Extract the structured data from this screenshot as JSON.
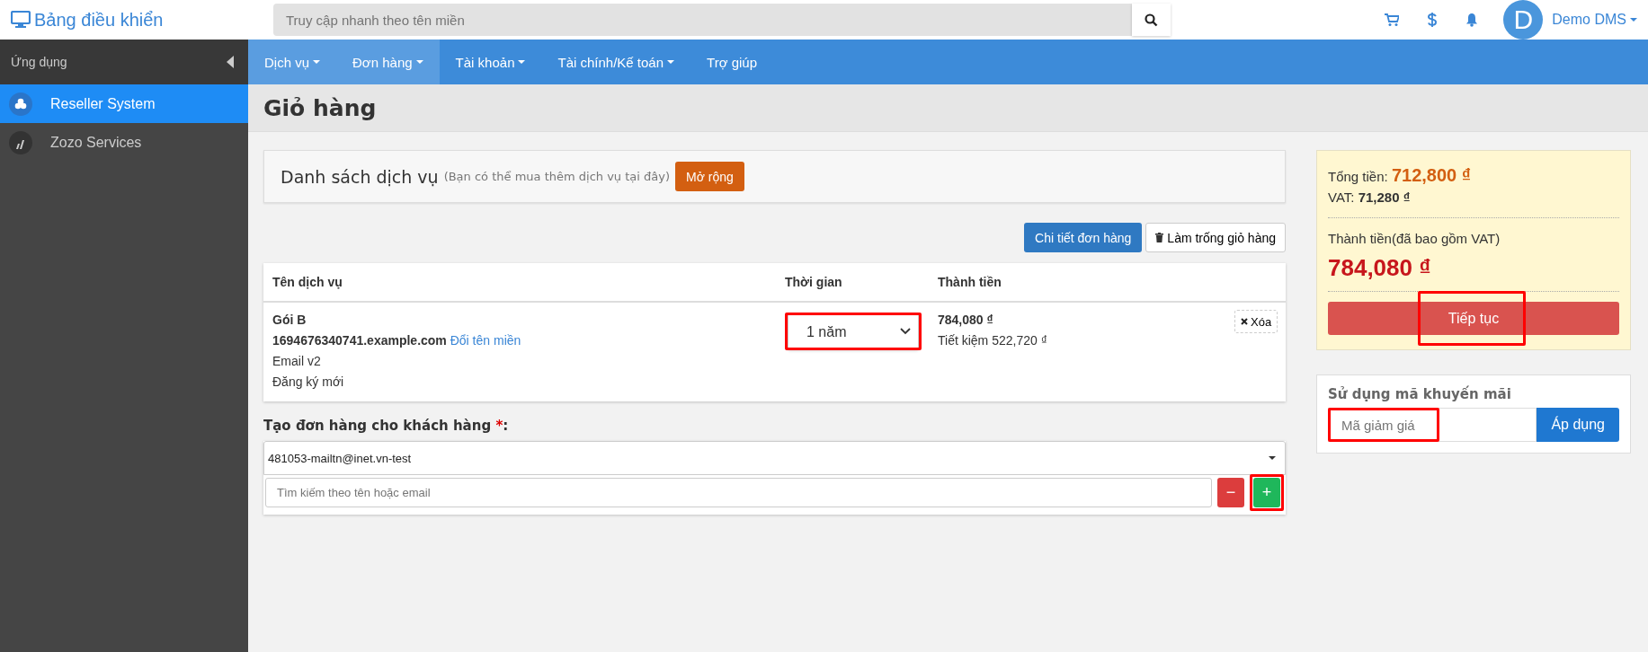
{
  "header": {
    "brand": "Bảng điều khiển",
    "search": {
      "placeholder": "Truy cập nhanh theo tên miền"
    },
    "avatar_letter": "D",
    "user": "Demo DMS"
  },
  "sidebar": {
    "title": "Ứng dụng",
    "items": [
      {
        "label": "Reseller System",
        "selected": true
      },
      {
        "label": "Zozo Services",
        "selected": false
      }
    ]
  },
  "nav": [
    {
      "label": "Dịch vụ",
      "dropdown": true,
      "selected": true
    },
    {
      "label": "Đơn hàng",
      "dropdown": true,
      "selected": true
    },
    {
      "label": "Tài khoản",
      "dropdown": true,
      "selected": false
    },
    {
      "label": "Tài chính/Kế toán",
      "dropdown": true,
      "selected": false
    },
    {
      "label": "Trợ giúp",
      "dropdown": false,
      "selected": false
    }
  ],
  "page_title": "Giỏ hàng",
  "services_card": {
    "title": "Danh sách dịch vụ",
    "note": "(Bạn có thể mua thêm dịch vụ tại đây)",
    "button": "Mở rộng"
  },
  "actions": [
    "Chi tiết đơn hàng",
    "Làm trống giỏ hàng"
  ],
  "table": {
    "columns": [
      "Tên dịch vụ",
      "Thời gian",
      "Thành tiền"
    ],
    "rows": [
      {
        "name": "Gói B",
        "domain": "1694676340741.example.com",
        "rename_link": "Đổi tên miền",
        "lines": [
          "Email v2",
          "Đăng ký mới"
        ],
        "period": "1 năm",
        "price": "784,080 ₫",
        "saving": "Tiết kiệm 522,720 ₫",
        "delete": "Xóa"
      }
    ]
  },
  "customer": {
    "label": "Tạo đơn hàng cho khách hàng",
    "required": "*",
    "suffix": ":",
    "selected": "481053-mailtn@inet.vn-test",
    "search": {
      "placeholder": "Tìm kiếm theo tên hoặc email"
    },
    "minus": "−",
    "plus": "+"
  },
  "summary": {
    "total_label": "Tổng tiền:",
    "total": "712,800 ₫",
    "vat_label": "VAT:",
    "vat": "71,280 ₫",
    "grand_label": "Thành tiền(đã bao gồm VAT)",
    "grand": "784,080 ₫",
    "button": "Tiếp tục"
  },
  "promo": {
    "title": "Sử dụng mã khuyến mãi",
    "placeholder": "Mã giảm giá",
    "button": "Áp dụng"
  }
}
